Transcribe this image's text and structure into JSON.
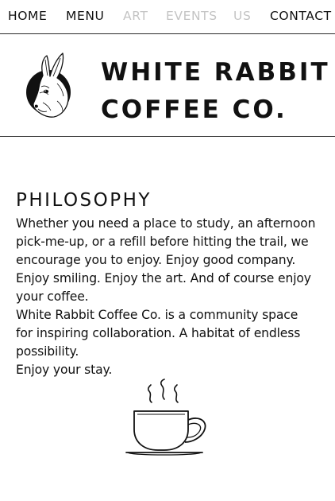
{
  "nav": {
    "items": [
      {
        "label": "HOME",
        "muted": false
      },
      {
        "label": "MENU",
        "muted": false
      },
      {
        "label": "ART",
        "muted": true
      },
      {
        "label": "EVENTS",
        "muted": true
      },
      {
        "label": "US",
        "muted": true
      },
      {
        "label": "CONTACT",
        "muted": false
      }
    ]
  },
  "header": {
    "brand_line1": "WHITE RABBIT",
    "brand_line2": "COFFEE CO.",
    "logo_icon": "rabbit-logo-icon"
  },
  "philosophy": {
    "heading": "PHILOSOPHY",
    "paragraphs": [
      "Whether you need a place to study, an afternoon pick-me-up, or a refill before hitting the trail, we encourage you to enjoy. Enjoy good company.",
      "Enjoy smiling. Enjoy the art. And of course enjoy your coffee.",
      "White Rabbit Coffee Co. is a community space for inspiring collaboration. A habitat of endless possibility.",
      "Enjoy your stay."
    ],
    "cup_icon": "coffee-cup-icon"
  },
  "colors": {
    "text": "#111111",
    "muted_nav": "#c4c4c4",
    "divider": "#2a2a2a",
    "background": "#ffffff"
  }
}
